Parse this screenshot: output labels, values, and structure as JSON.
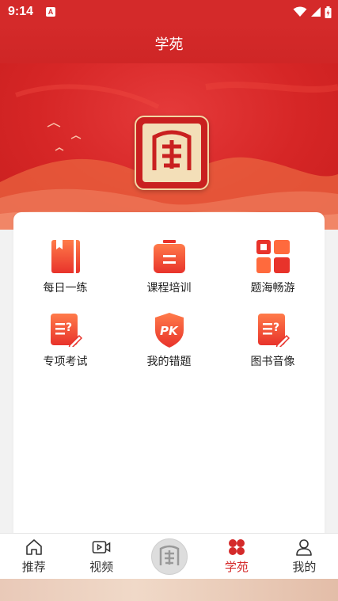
{
  "status_bar": {
    "time": "9:14",
    "notification_badge": "A",
    "icons": [
      "wifi-icon",
      "signal-icon",
      "battery-icon"
    ]
  },
  "header": {
    "title": "学苑"
  },
  "banner": {
    "logo": "seal-logo"
  },
  "menu": {
    "items": [
      {
        "label": "每日一练",
        "icon": "notebook-icon"
      },
      {
        "label": "课程培训",
        "icon": "briefcase-icon"
      },
      {
        "label": "题海畅游",
        "icon": "grid-icon"
      },
      {
        "label": "专项考试",
        "icon": "exam-edit-icon"
      },
      {
        "label": "我的错题",
        "icon": "pk-shield-icon"
      },
      {
        "label": "图书音像",
        "icon": "book-edit-icon"
      }
    ]
  },
  "bottom_nav": {
    "items": [
      {
        "label": "推荐",
        "icon": "home-icon"
      },
      {
        "label": "视频",
        "icon": "video-icon"
      },
      {
        "label": "",
        "icon": "center-logo"
      },
      {
        "label": "学苑",
        "icon": "clover-icon",
        "active": true
      },
      {
        "label": "我的",
        "icon": "user-icon"
      }
    ]
  },
  "colors": {
    "primary": "#d42a2a",
    "accent_gradient_start": "#ff7b4a",
    "accent_gradient_end": "#e8332b"
  }
}
